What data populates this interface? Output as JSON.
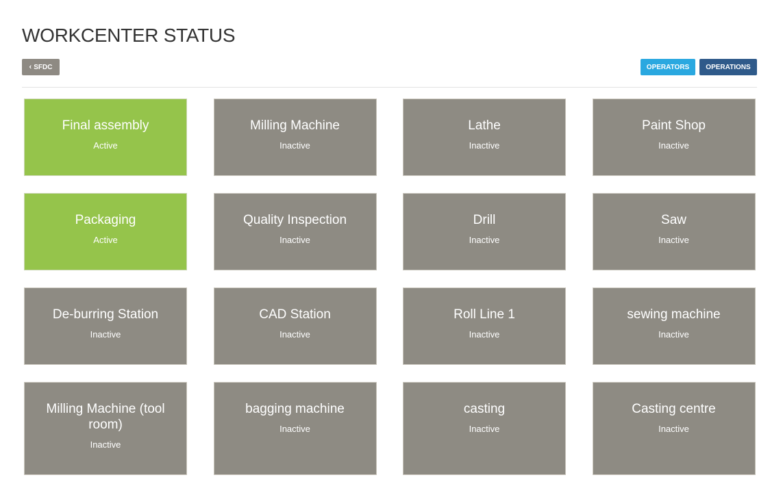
{
  "header": {
    "title": "WORKCENTER STATUS"
  },
  "toolbar": {
    "back_button": {
      "label": "SFDC",
      "icon": "chevron-left-icon"
    },
    "operators_label": "OPERATORS",
    "operations_label": "OPERATIONS"
  },
  "colors": {
    "active": "#95c44b",
    "inactive": "#8e8b83",
    "operators_button": "#2aa8e0",
    "operations_button": "#2f5a8a",
    "back_button": "#8e8a83"
  },
  "workcenters": [
    {
      "name": "Final assembly",
      "status": "Active"
    },
    {
      "name": "Milling Machine",
      "status": "Inactive"
    },
    {
      "name": "Lathe",
      "status": "Inactive"
    },
    {
      "name": "Paint Shop",
      "status": "Inactive"
    },
    {
      "name": "Packaging",
      "status": "Active"
    },
    {
      "name": "Quality Inspection",
      "status": "Inactive"
    },
    {
      "name": "Drill",
      "status": "Inactive"
    },
    {
      "name": "Saw",
      "status": "Inactive"
    },
    {
      "name": "De-burring Station",
      "status": "Inactive"
    },
    {
      "name": "CAD Station",
      "status": "Inactive"
    },
    {
      "name": "Roll Line 1",
      "status": "Inactive"
    },
    {
      "name": "sewing machine",
      "status": "Inactive"
    },
    {
      "name": "Milling Machine (tool room)",
      "status": "Inactive"
    },
    {
      "name": "bagging machine",
      "status": "Inactive"
    },
    {
      "name": "casting",
      "status": "Inactive"
    },
    {
      "name": "Casting centre",
      "status": "Inactive"
    }
  ]
}
